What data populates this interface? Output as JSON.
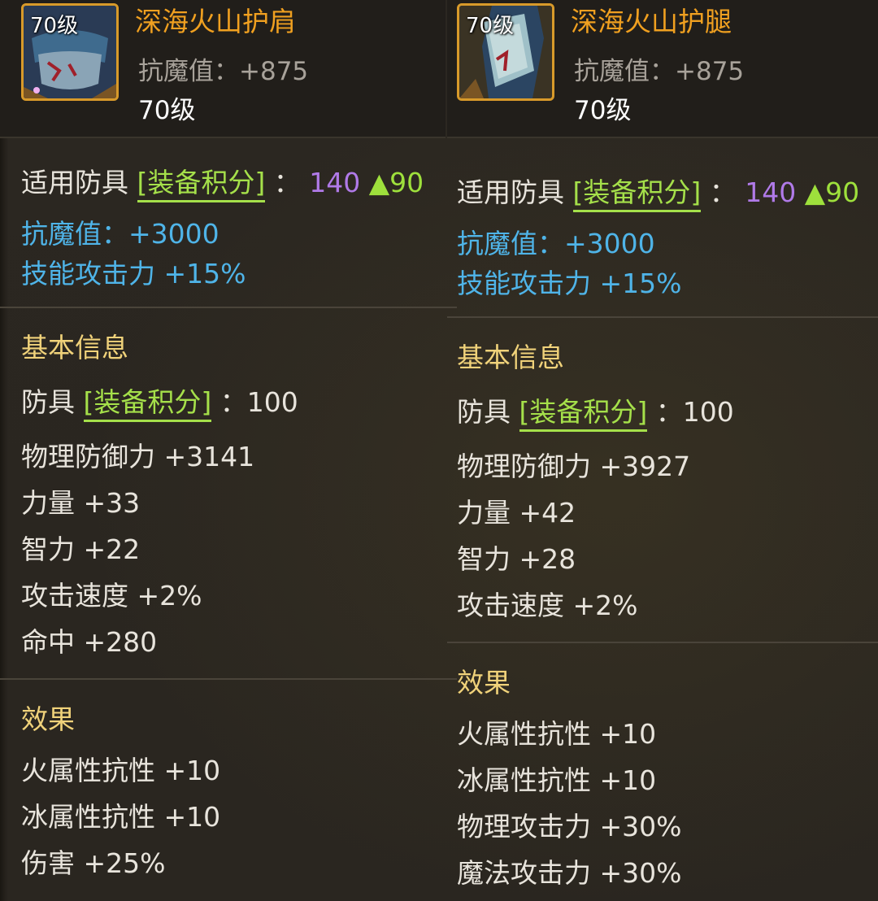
{
  "items": [
    {
      "level_badge": "70级",
      "name": "深海火山护肩",
      "header_stat": "抗魔值：+875",
      "header_level": "70级",
      "score": {
        "prefix": "适用防具",
        "keyword": "[装备积分]",
        "colon": "：",
        "value": "140",
        "delta": "▲90"
      },
      "bonus_lines": [
        "抗魔值：+3000",
        "技能攻击力 +15%"
      ],
      "basic": {
        "title": "基本信息",
        "score_prefix": "防具",
        "score_keyword": "[装备积分]",
        "score_rest": "：100",
        "stats": [
          "物理防御力 +3141",
          "力量 +33",
          "智力 +22",
          "攻击速度 +2%",
          "命中 +280"
        ]
      },
      "effects": {
        "title": "效果",
        "lines": [
          "火属性抗性 +10",
          "冰属性抗性 +10",
          "伤害 +25%"
        ]
      }
    },
    {
      "level_badge": "70级",
      "name": "深海火山护腿",
      "header_stat": "抗魔值：+875",
      "header_level": "70级",
      "score": {
        "prefix": "适用防具",
        "keyword": "[装备积分]",
        "colon": "：",
        "value": "140",
        "delta": "▲90"
      },
      "bonus_lines": [
        "抗魔值：+3000",
        "技能攻击力 +15%"
      ],
      "basic": {
        "title": "基本信息",
        "score_prefix": "防具",
        "score_keyword": "[装备积分]",
        "score_rest": "：100",
        "stats": [
          "物理防御力 +3927",
          "力量 +42",
          "智力 +28",
          "攻击速度 +2%"
        ]
      },
      "effects": {
        "title": "效果",
        "lines": [
          "火属性抗性 +10",
          "冰属性抗性 +10",
          "物理攻击力 +30%",
          "魔法攻击力 +30%"
        ]
      }
    }
  ],
  "colors": {
    "item_name": "#f0a020",
    "keyword": "#a5e04a",
    "score_value": "#b07ae8",
    "score_delta": "#9ee03c",
    "bonus": "#4fb4e8",
    "section_title": "#f0d27a",
    "icon_border": "#d89a2a"
  }
}
